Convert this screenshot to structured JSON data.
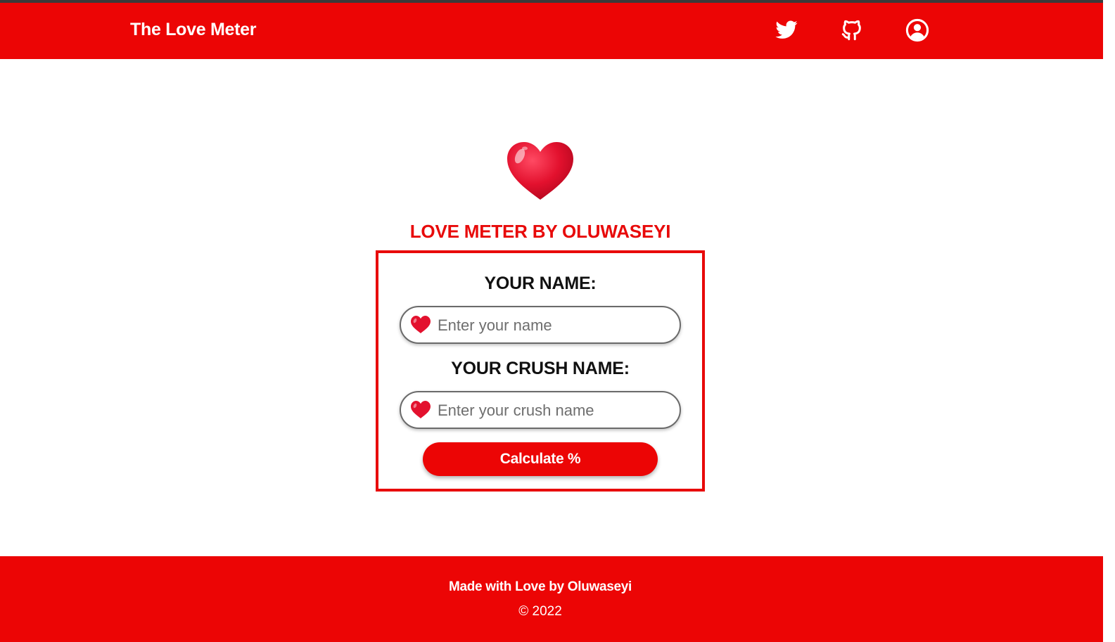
{
  "header": {
    "brand": "The Love Meter",
    "icons": [
      "twitter-icon",
      "github-icon",
      "user-icon"
    ]
  },
  "main": {
    "title": "LOVE METER BY OLUWASEYI",
    "name_label": "YOUR NAME:",
    "name_placeholder": "Enter your name",
    "name_value": "",
    "crush_label": "YOUR CRUSH NAME:",
    "crush_placeholder": "Enter your crush name",
    "crush_value": "",
    "button_label": "Calculate %"
  },
  "footer": {
    "credit": "Made with Love by Oluwaseyi",
    "copyright": "© 2022"
  },
  "colors": {
    "brand_red": "#ec0505",
    "title_red": "#e80a0a",
    "heart_red": "#e3112e"
  }
}
